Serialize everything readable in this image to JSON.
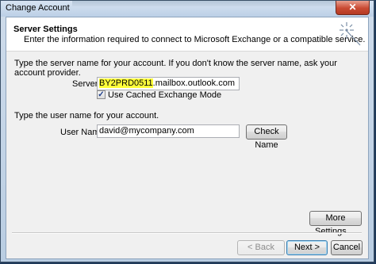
{
  "window": {
    "title": "Change Account",
    "close_label": "✕"
  },
  "header": {
    "title": "Server Settings",
    "description": "Enter the information required to connect to Microsoft Exchange or a compatible service.",
    "icon": "wizard-sparkle-icon"
  },
  "server": {
    "instructions_line1": "Type the server name for your account. If you don't know the server name, ask your",
    "instructions_line2": "account provider.",
    "label": "Server:",
    "value_highlighted": "BY2PRD0511",
    "value_rest": ".mailbox.outlook.com",
    "cached_mode_checked": true,
    "cached_mode_label": "Use Cached Exchange Mode"
  },
  "user": {
    "instructions": "Type the user name for your account.",
    "label": "User Name:",
    "value": "david@mycompany.com",
    "check_name_label": "Check Name"
  },
  "buttons": {
    "more_settings": "More Settings ...",
    "back": "< Back",
    "next": "Next >",
    "cancel": "Cancel"
  }
}
